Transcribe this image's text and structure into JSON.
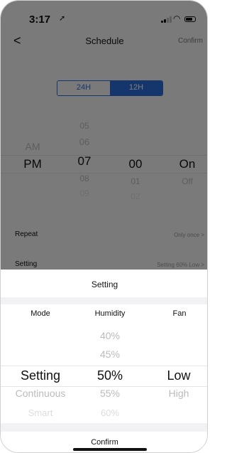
{
  "status": {
    "time": "3:17",
    "location_arrow": "➚",
    "wifi_icon": "wifi-icon",
    "battery_icon": "battery-icon"
  },
  "nav": {
    "back_icon": "<",
    "title": "Schedule",
    "confirm_label": "Confirm"
  },
  "mode_toggle": {
    "option_24h": "24H",
    "option_12h": "12H",
    "selected": "12H"
  },
  "time_picker": {
    "ampm": [
      "AM",
      "PM"
    ],
    "hours": [
      "05",
      "06",
      "07",
      "08",
      "09"
    ],
    "minutes": [
      "00",
      "01",
      "02"
    ],
    "state": [
      "On",
      "Off"
    ],
    "selected": {
      "ampm": "PM",
      "hour": "07",
      "minute": "00",
      "state": "On"
    }
  },
  "rows": {
    "repeat_label": "Repeat",
    "repeat_value": "Only once  >",
    "setting_label": "Setting",
    "setting_value": "Setting 60% Low  >"
  },
  "sheet": {
    "title": "Setting",
    "columns": {
      "mode": "Mode",
      "humidity": "Humidity",
      "fan": "Fan"
    },
    "mode_options": [
      "Setting",
      "Continuous",
      "Smart"
    ],
    "humidity_options": [
      "40%",
      "45%",
      "50%",
      "55%",
      "60%"
    ],
    "fan_options": [
      "Low",
      "High"
    ],
    "selected": {
      "mode": "Setting",
      "humidity": "50%",
      "fan": "Low"
    },
    "confirm_label": "Confirm"
  }
}
